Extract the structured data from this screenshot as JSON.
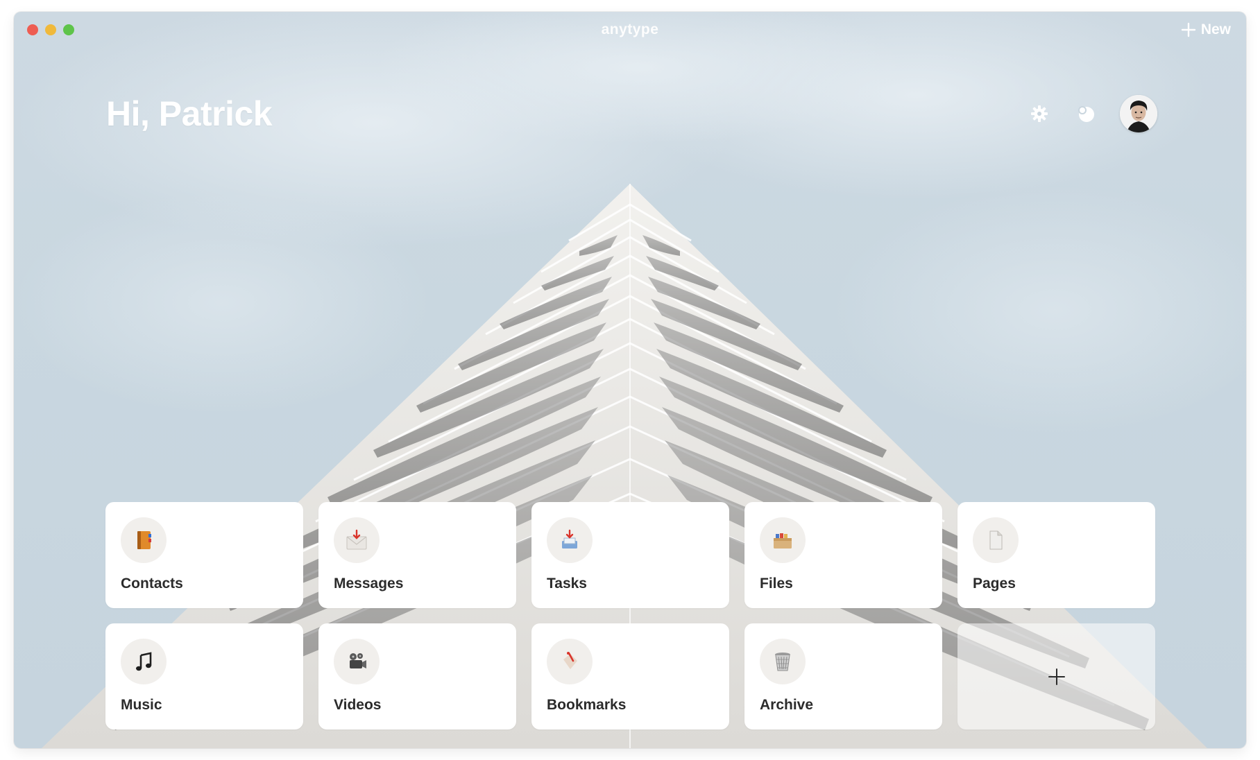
{
  "window": {
    "app_title": "anytype",
    "new_button_label": "New"
  },
  "header": {
    "greeting": "Hi, Patrick",
    "actions": [
      {
        "icon": "gear-icon"
      },
      {
        "icon": "theme-toggle-icon"
      },
      {
        "icon": "avatar"
      }
    ]
  },
  "tiles": [
    {
      "label": "Contacts",
      "icon": "address-book-icon"
    },
    {
      "label": "Messages",
      "icon": "envelope-icon"
    },
    {
      "label": "Tasks",
      "icon": "inbox-tray-icon"
    },
    {
      "label": "Files",
      "icon": "file-box-icon"
    },
    {
      "label": "Pages",
      "icon": "document-page-icon"
    },
    {
      "label": "Music",
      "icon": "music-note-icon"
    },
    {
      "label": "Videos",
      "icon": "film-projector-icon"
    },
    {
      "label": "Bookmarks",
      "icon": "bookmark-tag-icon"
    },
    {
      "label": "Archive",
      "icon": "trash-bin-icon"
    },
    {
      "label": "",
      "icon": "plus-icon"
    }
  ],
  "colors": {
    "sky": "#cdd9e2",
    "tile_bg": "#ffffff",
    "tile_icon_bg": "#f1efec",
    "text_dark": "#2b2b2b",
    "traffic_red": "#ee5d52",
    "traffic_yellow": "#f0b93b",
    "traffic_green": "#5ec44a"
  }
}
